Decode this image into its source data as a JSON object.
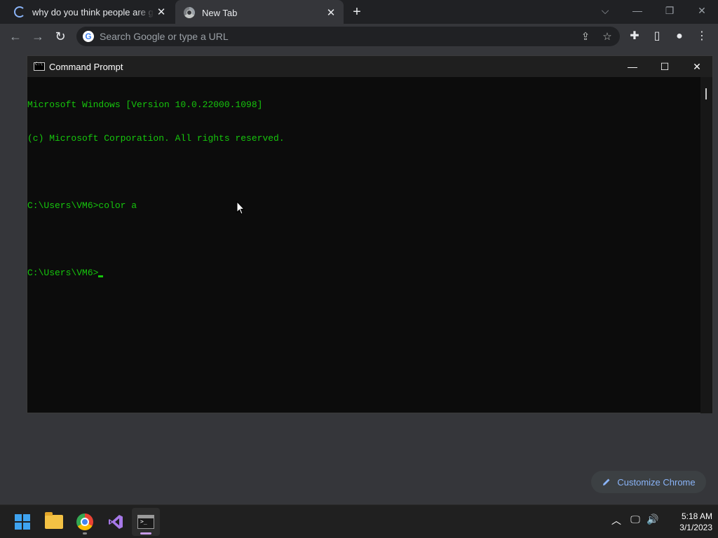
{
  "browser": {
    "tabs": [
      {
        "title": "why do you think people are gae",
        "icon": "loading-spinner-icon"
      },
      {
        "title": "New Tab",
        "icon": "chrome-icon"
      }
    ],
    "omnibox_placeholder": "Search Google or type a URL",
    "customize_label": "Customize Chrome"
  },
  "cmd": {
    "title": "Command Prompt",
    "lines": [
      "Microsoft Windows [Version 10.0.22000.1098]",
      "(c) Microsoft Corporation. All rights reserved.",
      "",
      "C:\\Users\\VM6>color a",
      "",
      "C:\\Users\\VM6>"
    ],
    "text_color": "#16c60c"
  },
  "taskbar": {
    "apps": [
      "start-icon",
      "file-explorer-icon",
      "chrome-icon",
      "visual-studio-icon",
      "terminal-icon"
    ],
    "time": "5:18 AM",
    "date": "3/1/2023"
  }
}
